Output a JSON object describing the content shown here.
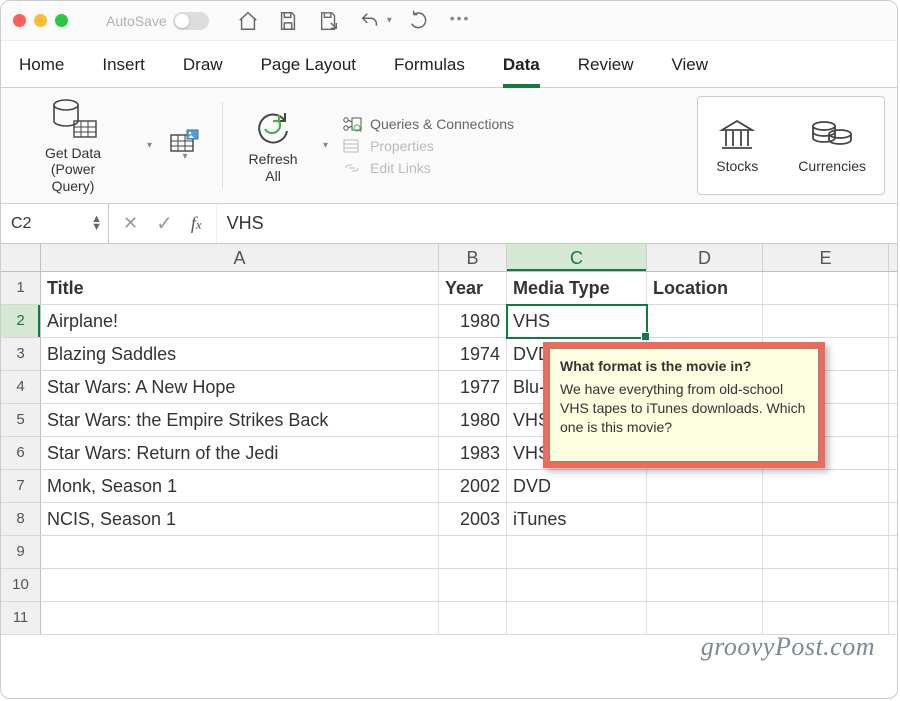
{
  "titlebar": {
    "autosave": "AutoSave"
  },
  "tabs": [
    "Home",
    "Insert",
    "Draw",
    "Page Layout",
    "Formulas",
    "Data",
    "Review",
    "View"
  ],
  "active_tab": "Data",
  "ribbon": {
    "get_data": "Get Data (Power\nQuery)",
    "refresh_all": "Refresh\nAll",
    "queries": "Queries & Connections",
    "properties": "Properties",
    "edit_links": "Edit Links",
    "stocks": "Stocks",
    "currencies": "Currencies"
  },
  "formula_bar": {
    "namebox": "C2",
    "value": "VHS"
  },
  "columns": [
    "A",
    "B",
    "C",
    "D",
    "E"
  ],
  "headers": {
    "A": "Title",
    "B": "Year",
    "C": "Media Type",
    "D": "Location"
  },
  "rows": [
    {
      "n": 1
    },
    {
      "n": 2,
      "A": "Airplane!",
      "B": "1980",
      "C": "VHS"
    },
    {
      "n": 3,
      "A": "Blazing Saddles",
      "B": "1974",
      "C": "DVD"
    },
    {
      "n": 4,
      "A": "Star Wars: A New Hope",
      "B": "1977",
      "C": "Blu-ray"
    },
    {
      "n": 5,
      "A": "Star Wars: the Empire Strikes Back",
      "B": "1980",
      "C": "VHS"
    },
    {
      "n": 6,
      "A": "Star Wars: Return of the Jedi",
      "B": "1983",
      "C": "VHS"
    },
    {
      "n": 7,
      "A": "Monk, Season 1",
      "B": "2002",
      "C": "DVD"
    },
    {
      "n": 8,
      "A": "NCIS, Season 1",
      "B": "2003",
      "C": "iTunes"
    },
    {
      "n": 9
    },
    {
      "n": 10
    },
    {
      "n": 11
    }
  ],
  "tooltip": {
    "title": "What format is the movie in?",
    "body": "We have everything from old-school VHS tapes to iTunes downloads. Which one is this movie?"
  },
  "watermark": "groovyPost.com"
}
